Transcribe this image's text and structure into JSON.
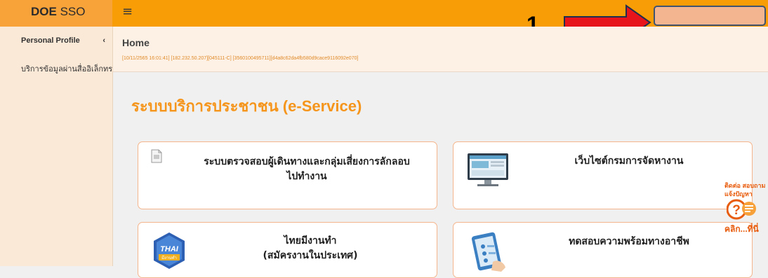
{
  "app": {
    "brand_bold": "DOE",
    "brand_rest": " SSO",
    "menu_icon": "hamburger-icon"
  },
  "annotation": {
    "number": "1",
    "arrow_color": "#e8141c"
  },
  "sidebar": {
    "items": [
      {
        "label": "Personal Profile",
        "chevron": "‹"
      },
      {
        "label": "บริการข้อมูลผ่านสื่ออิเล็กทรอนิก"
      }
    ]
  },
  "header": {
    "title": "Home",
    "session": "[10/11/2565 16:01:41] [182.232.50.207][045111-C] [3560100495711][d4a8c62da4fb580d9cace9116092e070]"
  },
  "main": {
    "section_title": "ระบบบริการประชาชน (e-Service)",
    "cards": [
      {
        "line1": "ระบบตรวจสอบผู้เดินทางและกลุ่มเสี่ยงการลักลอบ",
        "line2": "ไปทำงาน",
        "icon": "document-icon"
      },
      {
        "line1": "เว็บไซต์กรมการจัดหางาน",
        "line2": "",
        "icon": "monitor-icon"
      },
      {
        "line1": "ไทยมีงานทำ",
        "line2": "(สมัครงานในประเทศ)",
        "icon": "thai-job-logo",
        "logo_text_1": "THAI",
        "logo_text_2": "มีงานทำ"
      },
      {
        "line1": "ทดสอบความพร้อมทางอาชีพ",
        "line2": "",
        "icon": "tablet-icon"
      }
    ]
  },
  "help": {
    "line1": "ติดต่อ สอบถาม",
    "line2": "แจ้งปัญหา",
    "line3": "คลิก...ที่นี่",
    "icon": "question-chat-icon"
  },
  "colors": {
    "topbar": "#f99d06",
    "accent": "#f5951b",
    "card_border": "#f5b58c"
  }
}
